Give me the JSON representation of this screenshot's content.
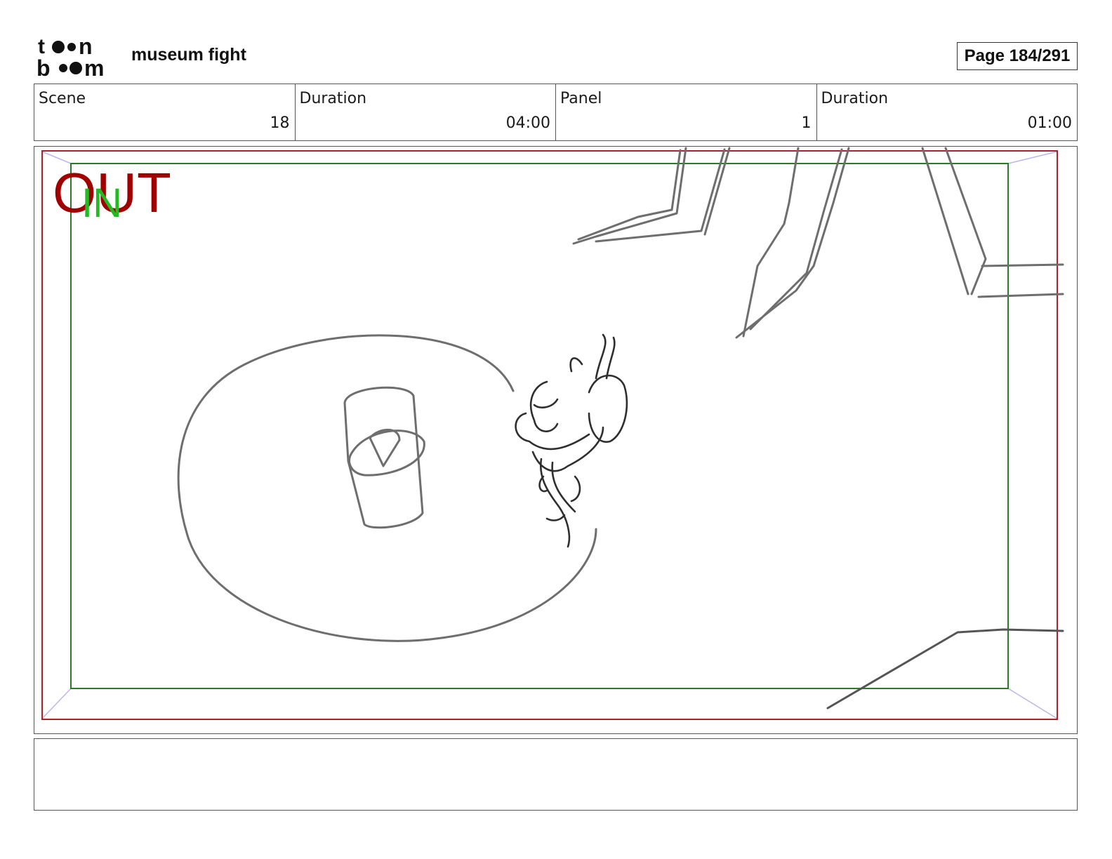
{
  "header": {
    "logo_text": [
      "to●n",
      "b●●m"
    ],
    "project_title": "museum fight",
    "page_indicator": "Page 184/291"
  },
  "info_table": [
    {
      "label": "Scene",
      "value": "18"
    },
    {
      "label": "Duration",
      "value": "04:00"
    },
    {
      "label": "Panel",
      "value": "1"
    },
    {
      "label": "Duration",
      "value": "01:00"
    }
  ],
  "panel": {
    "out_label": "OUT",
    "in_label": "IN",
    "colors": {
      "out_frame": "#b0202a",
      "in_frame": "#2a7a2a",
      "camera_diagonals": "#b8b8ee",
      "sketch": "#6e6e6e",
      "sketch_dark": "#2f2f2f"
    }
  },
  "notes": {
    "text": ""
  }
}
